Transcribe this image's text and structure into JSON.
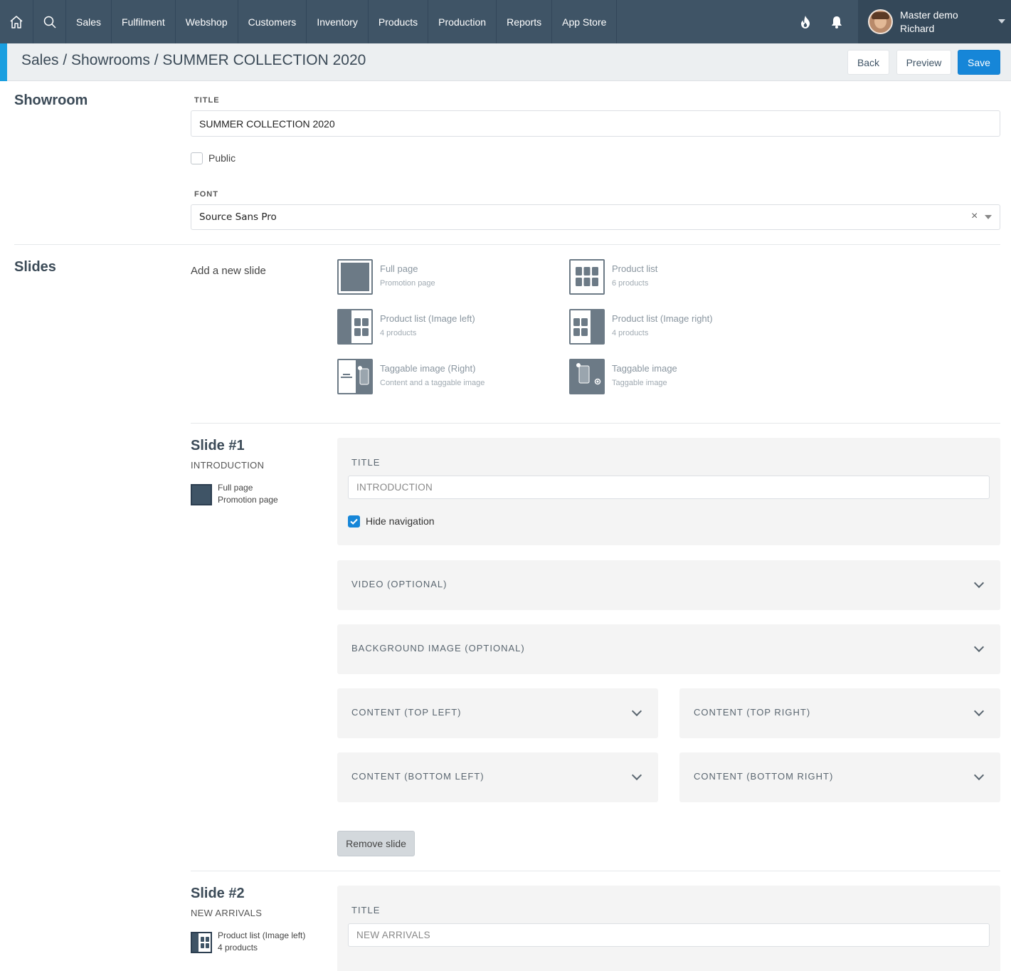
{
  "nav": {
    "items": [
      "Sales",
      "Fulfilment",
      "Webshop",
      "Customers",
      "Inventory",
      "Products",
      "Production",
      "Reports",
      "App Store"
    ],
    "icons": [
      "home-icon",
      "search-icon",
      "fire-icon",
      "bell-icon",
      "chevron-down-icon"
    ],
    "user_line1": "Master demo",
    "user_line2": "Richard"
  },
  "header": {
    "breadcrumb": "Sales / Showrooms / SUMMER COLLECTION 2020",
    "back_label": "Back",
    "preview_label": "Preview",
    "save_label": "Save"
  },
  "showroom": {
    "section_title": "Showroom",
    "title_label": "TITLE",
    "title_value": "SUMMER COLLECTION 2020",
    "public_label": "Public",
    "public_checked": false,
    "font_label": "FONT",
    "font_value": "Source Sans Pro"
  },
  "slides": {
    "section_title": "Slides",
    "add_label": "Add a new slide",
    "types": [
      {
        "name": "Full page",
        "sub": "Promotion page"
      },
      {
        "name": "Product list",
        "sub": "6 products"
      },
      {
        "name": "Product list (Image left)",
        "sub": "4 products"
      },
      {
        "name": "Product list (Image right)",
        "sub": "4 products"
      },
      {
        "name": "Taggable image (Right)",
        "sub": "Content and a taggable image"
      },
      {
        "name": "Taggable image",
        "sub": "Taggable image"
      }
    ]
  },
  "slide1": {
    "heading": "Slide #1",
    "sub": "INTRODUCTION",
    "type_name": "Full page",
    "type_sub": "Promotion page",
    "title_label": "TITLE",
    "title_placeholder": "INTRODUCTION",
    "hide_nav_label": "Hide navigation",
    "hide_nav_checked": true,
    "video_label": "VIDEO (OPTIONAL)",
    "bg_label": "BACKGROUND IMAGE (OPTIONAL)",
    "content_tl": "CONTENT (TOP LEFT)",
    "content_tr": "CONTENT (TOP RIGHT)",
    "content_bl": "CONTENT (BOTTOM LEFT)",
    "content_br": "CONTENT (BOTTOM RIGHT)",
    "remove_label": "Remove slide"
  },
  "slide2": {
    "heading": "Slide #2",
    "sub": "NEW ARRIVALS",
    "type_name": "Product list (Image left)",
    "type_sub": "4 products",
    "title_label": "TITLE",
    "title_placeholder": "NEW ARRIVALS"
  },
  "colors": {
    "nav_bg": "#3f5466",
    "accent": "#1a9fe0",
    "primary_button": "#1686d8"
  }
}
